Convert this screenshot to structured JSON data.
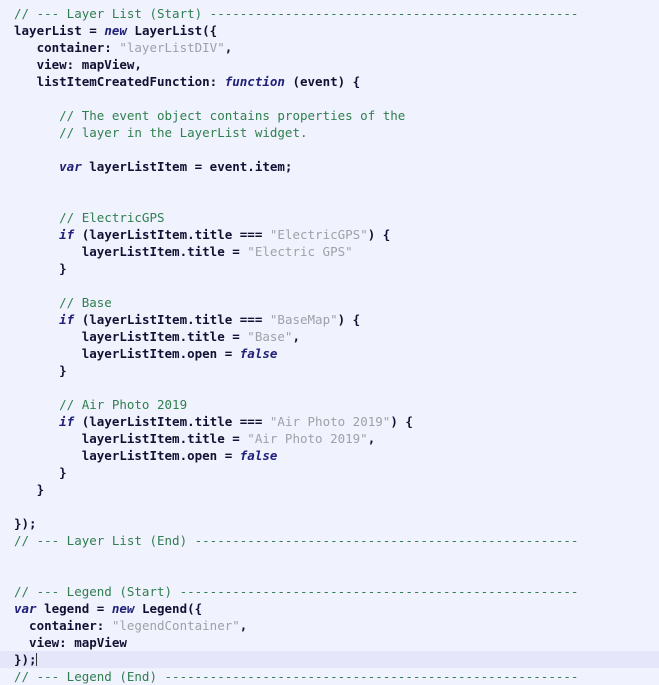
{
  "editor": {
    "language": "javascript",
    "background_color": "#f0f2fd",
    "current_line_color": "#e5e6fa",
    "colors": {
      "comment": "#2f7f4f",
      "plain": "#1a1a1a",
      "string": "#a0a0a8",
      "keyword": "#20207a"
    },
    "cursor": {
      "line": 36,
      "column": 4,
      "visible": true
    }
  },
  "lines": [
    {
      "n": 1,
      "current": false,
      "tokens": [
        {
          "t": "comment",
          "s": "// --- Layer List (Start) -------------------------------------------------"
        }
      ]
    },
    {
      "n": 2,
      "current": false,
      "tokens": [
        {
          "t": "bold",
          "s": "layerList = "
        },
        {
          "t": "kw",
          "s": "new"
        },
        {
          "t": "bold",
          "s": " LayerList({"
        }
      ]
    },
    {
      "n": 3,
      "current": false,
      "tokens": [
        {
          "t": "bold",
          "s": "   container: "
        },
        {
          "t": "string",
          "s": "\"layerListDIV\""
        },
        {
          "t": "bold",
          "s": ","
        }
      ]
    },
    {
      "n": 4,
      "current": false,
      "tokens": [
        {
          "t": "bold",
          "s": "   view: mapView,"
        }
      ]
    },
    {
      "n": 5,
      "current": false,
      "tokens": [
        {
          "t": "bold",
          "s": "   listItemCreatedFunction: "
        },
        {
          "t": "kw",
          "s": "function"
        },
        {
          "t": "bold",
          "s": " (event) {"
        }
      ]
    },
    {
      "n": 6,
      "current": false,
      "tokens": [
        {
          "t": "plain",
          "s": ""
        }
      ]
    },
    {
      "n": 7,
      "current": false,
      "tokens": [
        {
          "t": "comment",
          "s": "      // The event object contains properties of the"
        }
      ]
    },
    {
      "n": 8,
      "current": false,
      "tokens": [
        {
          "t": "comment",
          "s": "      // layer in the LayerList widget."
        }
      ]
    },
    {
      "n": 9,
      "current": false,
      "tokens": [
        {
          "t": "plain",
          "s": ""
        }
      ]
    },
    {
      "n": 10,
      "current": false,
      "tokens": [
        {
          "t": "kw",
          "s": "      var"
        },
        {
          "t": "bold",
          "s": " layerListItem = event.item;"
        }
      ]
    },
    {
      "n": 11,
      "current": false,
      "tokens": [
        {
          "t": "plain",
          "s": ""
        }
      ]
    },
    {
      "n": 12,
      "current": false,
      "tokens": [
        {
          "t": "plain",
          "s": ""
        }
      ]
    },
    {
      "n": 13,
      "current": false,
      "tokens": [
        {
          "t": "comment",
          "s": "      // ElectricGPS"
        }
      ]
    },
    {
      "n": 14,
      "current": false,
      "tokens": [
        {
          "t": "kw",
          "s": "      if"
        },
        {
          "t": "bold",
          "s": " (layerListItem.title === "
        },
        {
          "t": "string",
          "s": "\"ElectricGPS\""
        },
        {
          "t": "bold",
          "s": ") {"
        }
      ]
    },
    {
      "n": 15,
      "current": false,
      "tokens": [
        {
          "t": "bold",
          "s": "         layerListItem.title = "
        },
        {
          "t": "string",
          "s": "\"Electric GPS\""
        }
      ]
    },
    {
      "n": 16,
      "current": false,
      "tokens": [
        {
          "t": "bold",
          "s": "      }"
        }
      ]
    },
    {
      "n": 17,
      "current": false,
      "tokens": [
        {
          "t": "plain",
          "s": ""
        }
      ]
    },
    {
      "n": 18,
      "current": false,
      "tokens": [
        {
          "t": "comment",
          "s": "      // Base"
        }
      ]
    },
    {
      "n": 19,
      "current": false,
      "tokens": [
        {
          "t": "kw",
          "s": "      if"
        },
        {
          "t": "bold",
          "s": " (layerListItem.title === "
        },
        {
          "t": "string",
          "s": "\"BaseMap\""
        },
        {
          "t": "bold",
          "s": ") {"
        }
      ]
    },
    {
      "n": 20,
      "current": false,
      "tokens": [
        {
          "t": "bold",
          "s": "         layerListItem.title = "
        },
        {
          "t": "string",
          "s": "\"Base\""
        },
        {
          "t": "bold",
          "s": ","
        }
      ]
    },
    {
      "n": 21,
      "current": false,
      "tokens": [
        {
          "t": "bold",
          "s": "         layerListItem.open = "
        },
        {
          "t": "kw",
          "s": "false"
        }
      ]
    },
    {
      "n": 22,
      "current": false,
      "tokens": [
        {
          "t": "bold",
          "s": "      }"
        }
      ]
    },
    {
      "n": 23,
      "current": false,
      "tokens": [
        {
          "t": "plain",
          "s": ""
        }
      ]
    },
    {
      "n": 24,
      "current": false,
      "tokens": [
        {
          "t": "comment",
          "s": "      // Air Photo 2019"
        }
      ]
    },
    {
      "n": 25,
      "current": false,
      "tokens": [
        {
          "t": "kw",
          "s": "      if"
        },
        {
          "t": "bold",
          "s": " (layerListItem.title === "
        },
        {
          "t": "string",
          "s": "\"Air Photo 2019\""
        },
        {
          "t": "bold",
          "s": ") {"
        }
      ]
    },
    {
      "n": 26,
      "current": false,
      "tokens": [
        {
          "t": "bold",
          "s": "         layerListItem.title = "
        },
        {
          "t": "string",
          "s": "\"Air Photo 2019\""
        },
        {
          "t": "bold",
          "s": ","
        }
      ]
    },
    {
      "n": 27,
      "current": false,
      "tokens": [
        {
          "t": "bold",
          "s": "         layerListItem.open = "
        },
        {
          "t": "kw",
          "s": "false"
        }
      ]
    },
    {
      "n": 28,
      "current": false,
      "tokens": [
        {
          "t": "bold",
          "s": "      }"
        }
      ]
    },
    {
      "n": 29,
      "current": false,
      "tokens": [
        {
          "t": "bold",
          "s": "   }"
        }
      ]
    },
    {
      "n": 30,
      "current": false,
      "tokens": [
        {
          "t": "plain",
          "s": ""
        }
      ]
    },
    {
      "n": 31,
      "current": false,
      "tokens": [
        {
          "t": "bold",
          "s": "});"
        }
      ]
    },
    {
      "n": 32,
      "current": false,
      "tokens": [
        {
          "t": "comment",
          "s": "// --- Layer List (End) ---------------------------------------------------"
        }
      ]
    },
    {
      "n": 33,
      "current": false,
      "tokens": [
        {
          "t": "plain",
          "s": ""
        }
      ]
    },
    {
      "n": 34,
      "current": false,
      "tokens": [
        {
          "t": "plain",
          "s": ""
        }
      ]
    },
    {
      "n": 35,
      "current": false,
      "tokens": [
        {
          "t": "comment",
          "s": "// --- Legend (Start) -----------------------------------------------------"
        }
      ]
    },
    {
      "n": 36,
      "current": false,
      "tokens": [
        {
          "t": "kw",
          "s": "var"
        },
        {
          "t": "bold",
          "s": " legend = "
        },
        {
          "t": "kw",
          "s": "new"
        },
        {
          "t": "bold",
          "s": " Legend({"
        }
      ]
    },
    {
      "n": 37,
      "current": false,
      "tokens": [
        {
          "t": "bold",
          "s": "  container: "
        },
        {
          "t": "string",
          "s": "\"legendContainer\""
        },
        {
          "t": "bold",
          "s": ","
        }
      ]
    },
    {
      "n": 38,
      "current": false,
      "tokens": [
        {
          "t": "bold",
          "s": "  view: mapView"
        }
      ]
    },
    {
      "n": 39,
      "current": true,
      "caret_after": true,
      "tokens": [
        {
          "t": "bold",
          "s": "});"
        }
      ]
    },
    {
      "n": 40,
      "current": false,
      "tokens": [
        {
          "t": "comment",
          "s": "// --- Legend (End) -------------------------------------------------------"
        }
      ]
    }
  ]
}
